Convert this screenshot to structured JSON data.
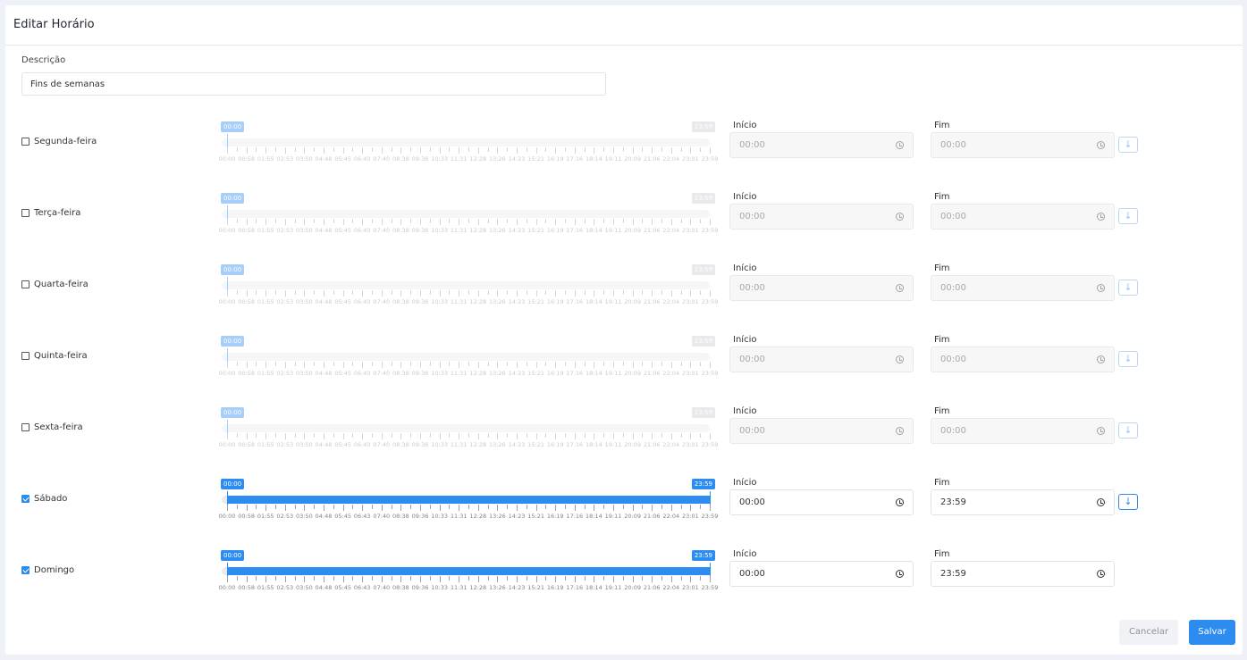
{
  "header": {
    "title": "Editar Horário"
  },
  "form": {
    "description_label": "Descrição",
    "description_value": "Fins de semanas"
  },
  "scale_labels": [
    "00:00",
    "00:58",
    "01:55",
    "02:53",
    "03:50",
    "04:48",
    "05:45",
    "06:43",
    "07:40",
    "08:38",
    "09:36",
    "10:33",
    "11:31",
    "12:28",
    "13:26",
    "14:23",
    "15:21",
    "16:19",
    "17:16",
    "18:14",
    "19:11",
    "20:09",
    "21:06",
    "22:04",
    "23:01",
    "23:59"
  ],
  "days": [
    {
      "label": "Segunda-feira",
      "checked": false,
      "start_label": "Início",
      "start": "00:00",
      "end_label": "Fim",
      "end": "00:00",
      "tip_start": "00:00",
      "tip_end": "23:59",
      "range": [
        0,
        0
      ],
      "copy": true
    },
    {
      "label": "Terça-feira",
      "checked": false,
      "start_label": "Início",
      "start": "00:00",
      "end_label": "Fim",
      "end": "00:00",
      "tip_start": "00:00",
      "tip_end": "23:59",
      "range": [
        0,
        0
      ],
      "copy": true
    },
    {
      "label": "Quarta-feira",
      "checked": false,
      "start_label": "Início",
      "start": "00:00",
      "end_label": "Fim",
      "end": "00:00",
      "tip_start": "00:00",
      "tip_end": "23:59",
      "range": [
        0,
        0
      ],
      "copy": true
    },
    {
      "label": "Quinta-feira",
      "checked": false,
      "start_label": "Início",
      "start": "00:00",
      "end_label": "Fim",
      "end": "00:00",
      "tip_start": "00:00",
      "tip_end": "23:59",
      "range": [
        0,
        0
      ],
      "copy": true
    },
    {
      "label": "Sexta-feira",
      "checked": false,
      "start_label": "Início",
      "start": "00:00",
      "end_label": "Fim",
      "end": "00:00",
      "tip_start": "00:00",
      "tip_end": "23:59",
      "range": [
        0,
        0
      ],
      "copy": true
    },
    {
      "label": "Sábado",
      "checked": true,
      "start_label": "Início",
      "start": "00:00",
      "end_label": "Fim",
      "end": "23:59",
      "tip_start": "00:00",
      "tip_end": "23:59",
      "range": [
        0,
        1
      ],
      "copy": true
    },
    {
      "label": "Domingo",
      "checked": true,
      "start_label": "Início",
      "start": "00:00",
      "end_label": "Fim",
      "end": "23:59",
      "tip_start": "00:00",
      "tip_end": "23:59",
      "range": [
        0,
        1
      ],
      "copy": false
    }
  ],
  "footer": {
    "cancel_label": "Cancelar",
    "save_label": "Salvar"
  },
  "colors": {
    "accent": "#2d8cf0"
  }
}
